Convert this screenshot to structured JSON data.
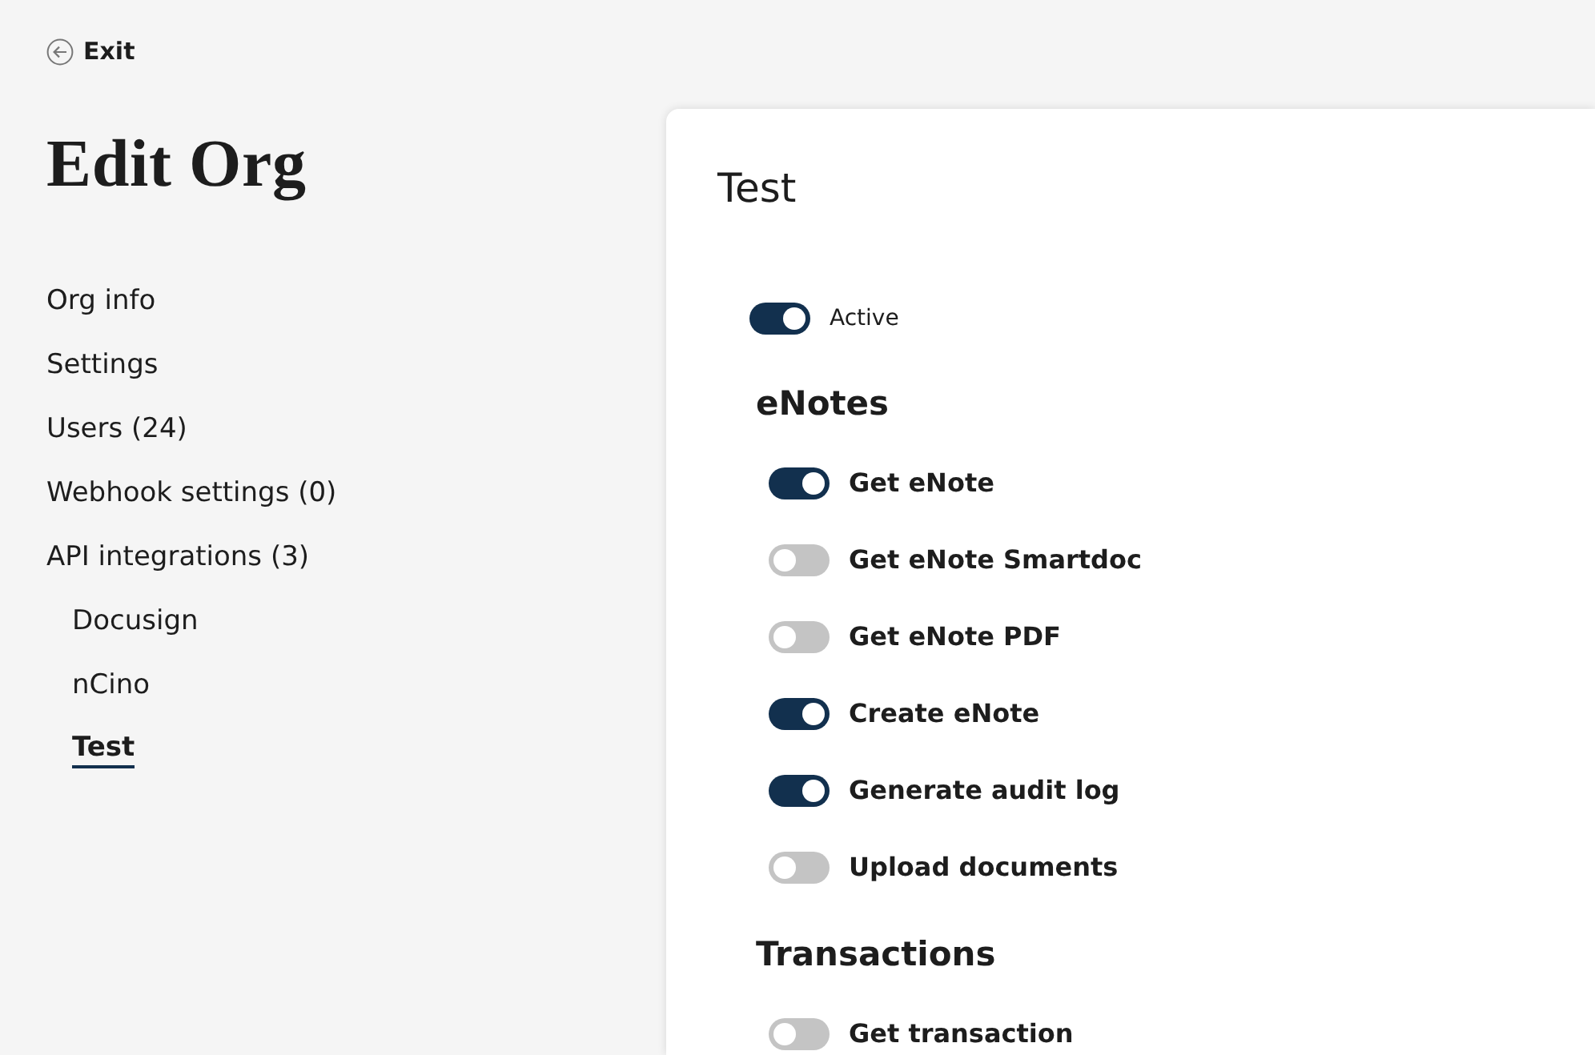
{
  "exit": {
    "label": "Exit"
  },
  "title": "Edit Org",
  "nav": [
    {
      "label": "Org info",
      "selected": false
    },
    {
      "label": "Settings",
      "selected": false
    },
    {
      "label": "Users (24)",
      "selected": false
    },
    {
      "label": "Webhook settings (0)",
      "selected": false
    },
    {
      "label": "API integrations (3)",
      "selected": false,
      "children": [
        {
          "label": "Docusign",
          "selected": false
        },
        {
          "label": "nCino",
          "selected": false
        },
        {
          "label": "Test",
          "selected": true
        }
      ]
    }
  ],
  "panel": {
    "title": "Test",
    "active": {
      "label": "Active",
      "on": true
    },
    "sections": [
      {
        "heading": "eNotes",
        "items": [
          {
            "label": "Get eNote",
            "on": true
          },
          {
            "label": "Get eNote Smartdoc",
            "on": false
          },
          {
            "label": "Get eNote PDF",
            "on": false
          },
          {
            "label": "Create eNote",
            "on": true
          },
          {
            "label": "Generate audit log",
            "on": true
          },
          {
            "label": "Upload documents",
            "on": false
          }
        ]
      },
      {
        "heading": "Transactions",
        "items": [
          {
            "label": "Get transaction",
            "on": false
          }
        ]
      }
    ]
  }
}
